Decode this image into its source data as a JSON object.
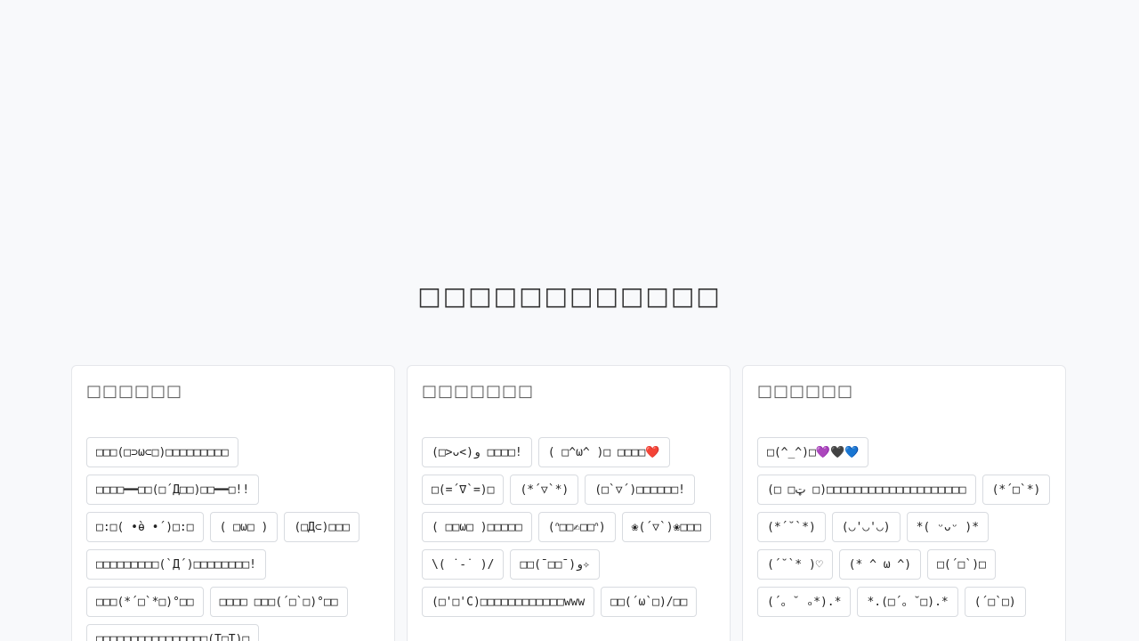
{
  "page": {
    "title": "□□□□□□□□□□□□"
  },
  "categories": [
    {
      "title": "□□□□□□",
      "items": [
        "□□□(□⊃ω⊂□)□□□□□□□□□",
        "□□□□━━□□(□´Д□□)□□━━□!!",
        "□:□( •̀ө •́ )□:□",
        "( □ω□ )",
        "(□Д⊂)□□□",
        "□□□□□□□□□(`Д´)□□□□□□□□!",
        "□□□(*´□`*□)°□□",
        "□□□□ □□□(´□`□)°□□",
        "□□□□□□□□□□□□□□□□(T□T)□"
      ]
    },
    {
      "title": "□□□□□□□",
      "items": [
        "(□>ᴗ<)و □□□□!",
        "( □^ω^ )□ □□□□❤️",
        "□(=´∇`=)□",
        "(*´▽`*)",
        "(□`▽´)□□□□□□!",
        "( □□ω□ )□□□□□",
        "(ᐢ□□✍□□ᐢ)",
        "❀(´▽`)❀□□□",
        "\\(  ˙-˙  )/",
        "□□( ̄□□ ̄)و✧",
        "(□'□'C)□□□□□□□□□□□□www",
        "□□(´ω`□)/□□"
      ]
    },
    {
      "title": "□□□□□□",
      "items": [
        "□(^_^)□💜🖤💙",
        "(□ □ټ □)□□□□□□□□□□□□□□□□□□□□",
        "(*´□`*)",
        "(*´˘`*)",
        "(◡'◡'◡)",
        "*( ᵕᴗᵕ )*",
        "(´˘`* )♡",
        "(* ^ ω ^)",
        "□(´□`)□",
        "(´。˘ ₒ*).*",
        "*.(□´。˘□).*",
        "(´□`□)"
      ]
    }
  ],
  "colors": {
    "background": "#f8f9fb",
    "card": "#ffffff",
    "border": "#d8dbe0",
    "text": "#222222"
  }
}
